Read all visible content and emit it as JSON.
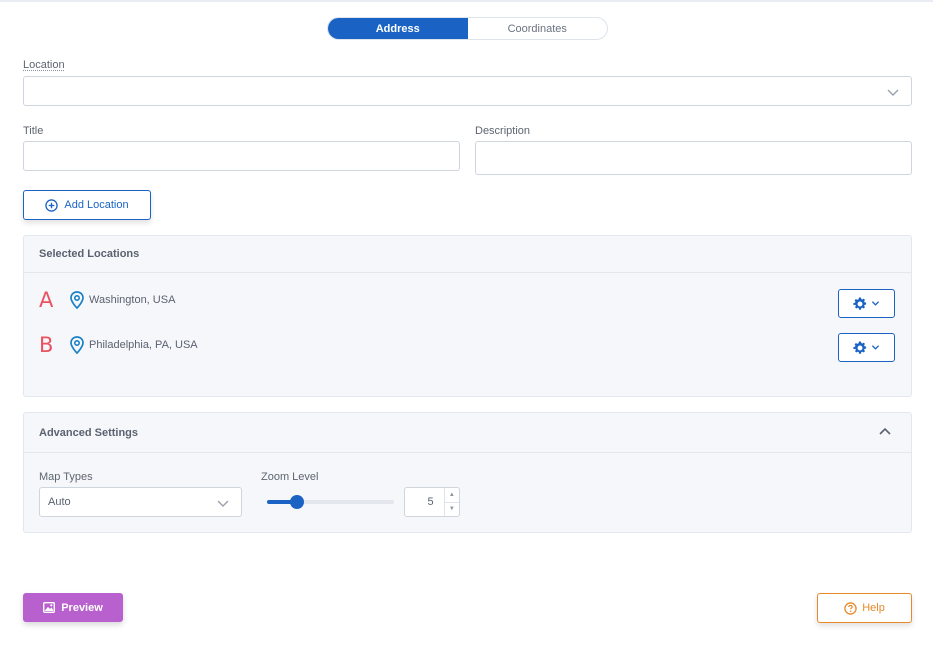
{
  "toggle": {
    "address_label": "Address",
    "coordinates_label": "Coordinates",
    "active": "Address"
  },
  "form": {
    "location_label": "Location",
    "location_value": "",
    "title_label": "Title",
    "title_value": "",
    "description_label": "Description",
    "description_value": ""
  },
  "add_location_label": "Add Location",
  "selected": {
    "heading": "Selected Locations",
    "items": [
      {
        "letter": "A",
        "name": "Washington, USA"
      },
      {
        "letter": "B",
        "name": "Philadelphia, PA, USA"
      }
    ]
  },
  "advanced": {
    "heading": "Advanced Settings",
    "map_types_label": "Map Types",
    "map_type_value": "Auto",
    "zoom_label": "Zoom Level",
    "zoom_value": "5",
    "zoom_slider_fraction": 0.24
  },
  "footer": {
    "preview_label": "Preview",
    "help_label": "Help"
  },
  "colors": {
    "accent": "#1a63c5",
    "marker_letter": "#e8535f",
    "preview": "#b860cd",
    "help": "#e8892a"
  },
  "icons": [
    "chevron-down-icon",
    "plus-circle-icon",
    "map-pin-icon",
    "gear-icon",
    "chevron-up-icon",
    "image-icon",
    "question-circle-icon"
  ]
}
